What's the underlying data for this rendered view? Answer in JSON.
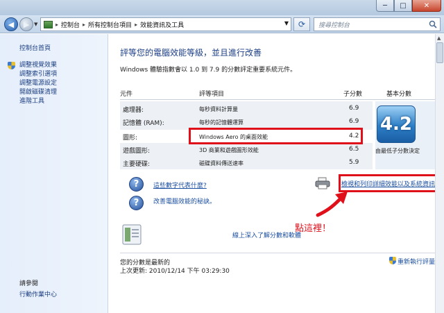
{
  "window": {
    "min_glyph": "─",
    "max_glyph": "□",
    "close_glyph": "✕"
  },
  "address_bar": {
    "crumbs": [
      "控制台",
      "所有控制台項目",
      "效能資訊及工具"
    ],
    "separator": "▸",
    "search_placeholder": "搜尋控制台"
  },
  "sidebar": {
    "home": "控制台首頁",
    "items": [
      "調整視覺效果",
      "調整索引選項",
      "調整電源設定",
      "開啟磁碟清理",
      "進階工具"
    ],
    "see_also": "請參閱",
    "action_center": "行動作業中心"
  },
  "main": {
    "title": "評等您的電腦效能等級，並且進行改善",
    "intro": "Windows 體驗指數會以 1.0 到 7.9 的分數評定重要系統元件。",
    "columns": {
      "component": "元件",
      "rated": "評等項目",
      "subscore": "子分數",
      "base": "基本分數"
    },
    "rows": [
      {
        "component": "處理器:",
        "rated": "每秒資料計算量",
        "subscore": "6.9"
      },
      {
        "component": "記憶體 (RAM):",
        "rated": "每秒的記憶體運算",
        "subscore": "6.9"
      },
      {
        "component": "圖形:",
        "rated": "Windows Aero 的桌面效能",
        "subscore": "4.2"
      },
      {
        "component": "遊戲圖形:",
        "rated": "3D 商業和遊戲圖形效能",
        "subscore": "6.5"
      },
      {
        "component": "主要硬碟:",
        "rated": "磁碟資料傳送速率",
        "subscore": "5.9"
      }
    ],
    "base_score": "4.2",
    "base_note": "由最低子分數決定",
    "link_meaning": "這些數字代表什麼?",
    "link_tips": "改善電腦效能的秘訣。",
    "link_print": "檢視和列印詳細效能以及系統資訊",
    "annotation": "點這裡！",
    "link_online": "線上深入了解分數和軟體",
    "status_current": "您的分數是最新的",
    "status_updated": "上次更新: 2010/12/14 下午 03:29:30",
    "rerun": "重新執行評量"
  },
  "colors": {
    "highlight_red": "#e0101b",
    "link_blue": "#1b4fa0",
    "title_blue": "#1d3f86"
  }
}
